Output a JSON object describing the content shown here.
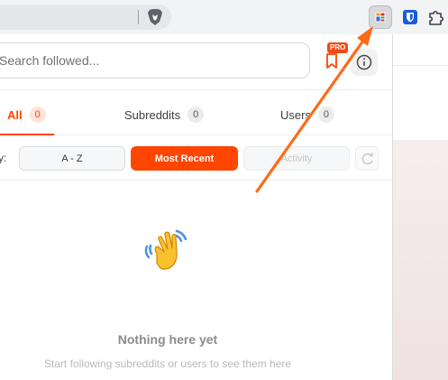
{
  "search": {
    "placeholder": "Search followed..."
  },
  "header": {
    "pro_badge": "PRO"
  },
  "tabs": [
    {
      "label": "All",
      "count": "0",
      "active": true
    },
    {
      "label": "Subreddits",
      "count": "0",
      "active": false
    },
    {
      "label": "Users",
      "count": "0",
      "active": false
    }
  ],
  "sort": {
    "label": "y:",
    "options": [
      "A - Z",
      "Most Recent",
      "Activity"
    ],
    "selected": "Most Recent"
  },
  "empty_state": {
    "title": "Nothing here yet",
    "subtitle": "Start following subreddits or users to see them here"
  },
  "icons": {
    "browser": "brave-lion-icon",
    "extension_active": "reddit-extension-icon",
    "extension_2": "bitwarden-shield-icon",
    "extension_3": "puzzle-piece-icon",
    "bookmark": "bookmark-icon",
    "info": "info-icon",
    "refresh": "refresh-icon",
    "empty": "waving-hand-icon"
  },
  "colors": {
    "accent": "#ff4500",
    "annotation_arrow": "#ff6a1a"
  }
}
